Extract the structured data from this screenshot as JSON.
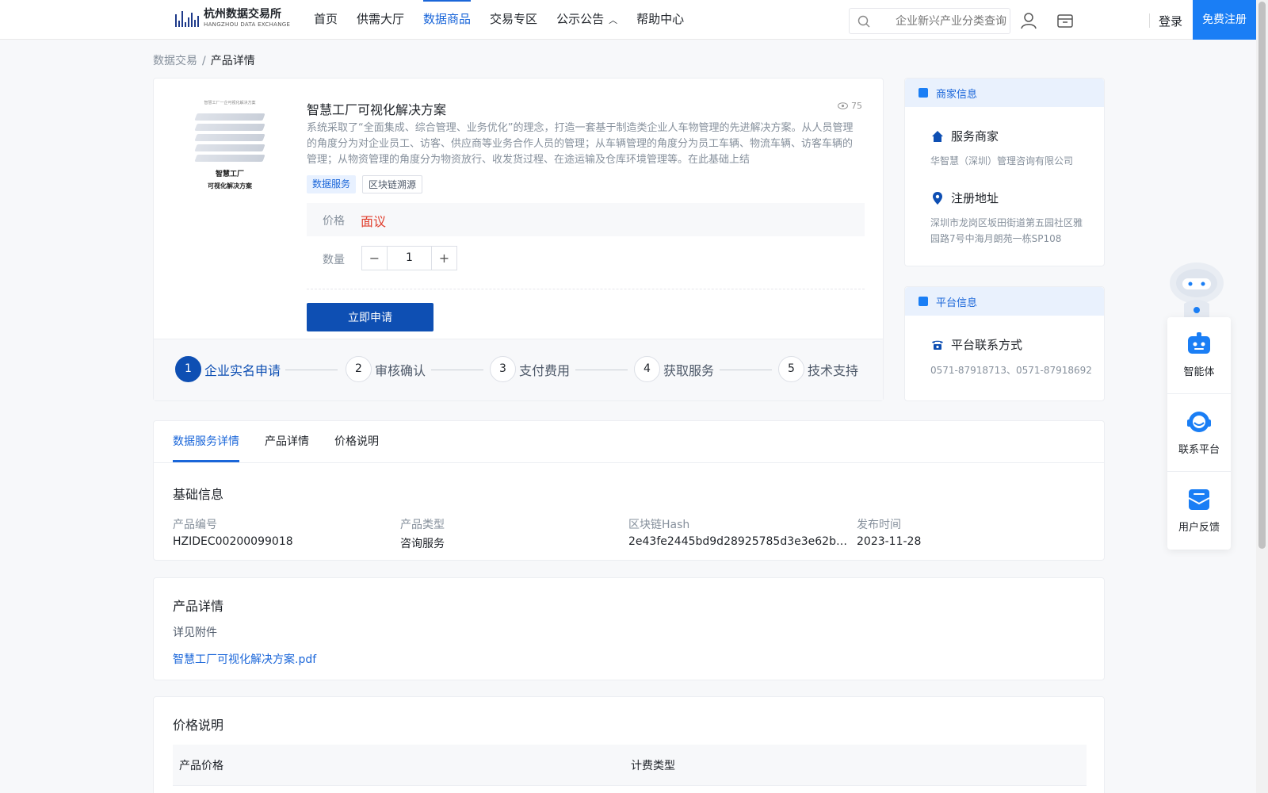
{
  "header": {
    "logo_cn": "杭州数据交易所",
    "logo_en": "HANGZHOU DATA EXCHANGE",
    "nav": [
      {
        "label": "首页"
      },
      {
        "label": "供需大厅"
      },
      {
        "label": "数据商品"
      },
      {
        "label": "交易专区"
      },
      {
        "label": "公示公告"
      },
      {
        "label": "帮助中心"
      }
    ],
    "search_placeholder": "企业新兴产业分类查询",
    "login": "登录",
    "register": "免费注册"
  },
  "breadcrumb": {
    "root": "数据交易",
    "sep": "/",
    "current": "产品详情"
  },
  "product": {
    "thumb_title_1": "智慧工厂",
    "thumb_title_2": "可视化解决方案",
    "thumb_header": "智慧工厂一企可视化解决方案",
    "title": "智慧工厂可视化解决方案",
    "views": "75",
    "description": "系统采取了“全面集成、综合管理、业务优化”的理念，打造一套基于制造类企业人车物管理的先进解决方案。从人员管理的角度分为对企业员工、访客、供应商等业务合作人员的管理；从车辆管理的角度分为员工车辆、物流车辆、访客车辆的管理；从物资管理的角度分为物资放行、收发货过程、在途运输及仓库环境管理等。在此基础上结",
    "tags": [
      "数据服务",
      "区块链溯源"
    ],
    "price_label": "价格",
    "price_value": "面议",
    "qty_label": "数量",
    "qty_value": "1",
    "apply_label": "立即申请"
  },
  "steps": [
    {
      "num": "1",
      "label": "企业实名申请"
    },
    {
      "num": "2",
      "label": "审核确认"
    },
    {
      "num": "3",
      "label": "支付费用"
    },
    {
      "num": "4",
      "label": "获取服务"
    },
    {
      "num": "5",
      "label": "技术支持"
    }
  ],
  "merchant": {
    "header": "商家信息",
    "service_label": "服务商家",
    "service_value": "华智慧（深圳）管理咨询有限公司",
    "address_label": "注册地址",
    "address_value": "深圳市龙岗区坂田街道第五园社区雅园路7号中海月朗苑一栋SP108"
  },
  "platform": {
    "header": "平台信息",
    "contact_label": "平台联系方式",
    "contact_value": "0571-87918713、0571-87918692"
  },
  "tabs": [
    {
      "label": "数据服务详情"
    },
    {
      "label": "产品详情"
    },
    {
      "label": "价格说明"
    }
  ],
  "basic": {
    "title": "基础信息",
    "fields": [
      {
        "label": "产品编号",
        "value": "HZIDEC00200099018"
      },
      {
        "label": "产品类型",
        "value": "咨询服务"
      },
      {
        "label": "区块链Hash",
        "value": "2e43fe2445bd9d28925785d3e3e62b740e…"
      },
      {
        "label": "发布时间",
        "value": "2023-11-28"
      }
    ]
  },
  "detail": {
    "title": "产品详情",
    "subtitle": "详见附件",
    "attachment": "智慧工厂可视化解决方案.pdf"
  },
  "pricing": {
    "title": "价格说明",
    "col_price": "产品价格",
    "col_type": "计费类型"
  },
  "float": {
    "items": [
      {
        "label": "智能体"
      },
      {
        "label": "联系平台"
      },
      {
        "label": "用户反馈"
      }
    ]
  },
  "colors": {
    "brand": "#1a66d9",
    "primary_button": "#0e4fb3",
    "price": "#e03e2d"
  }
}
